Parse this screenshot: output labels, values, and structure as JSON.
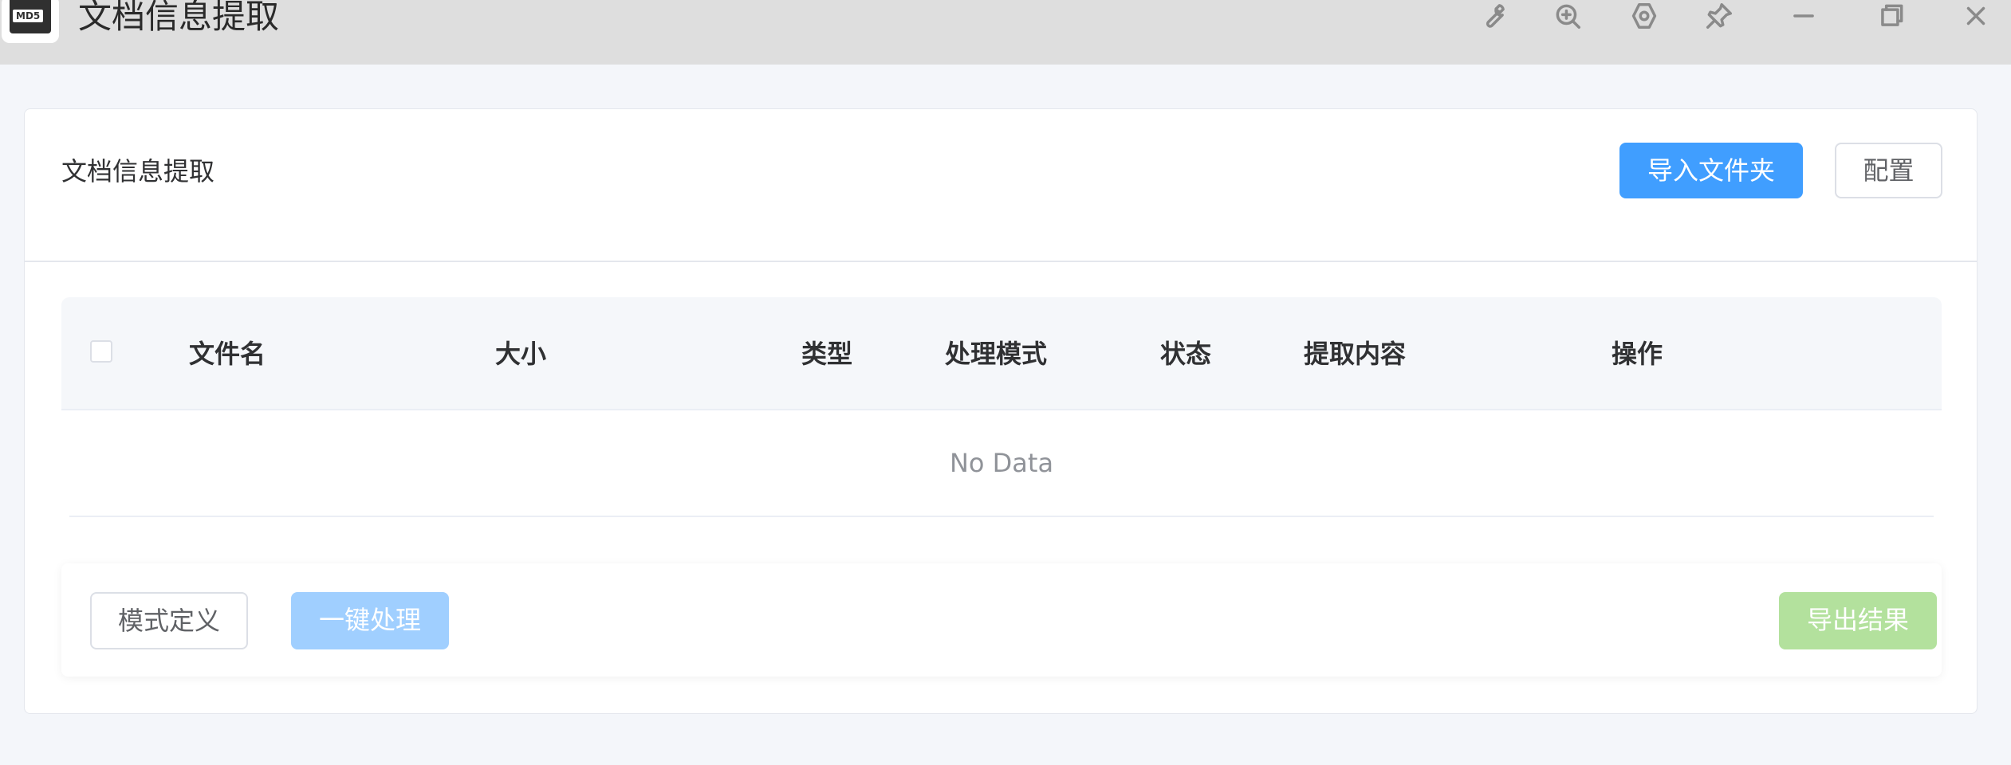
{
  "window": {
    "title": "文档信息提取",
    "logo_tag": "MD5"
  },
  "card": {
    "title": "文档信息提取",
    "import_folder_label": "导入文件夹",
    "config_label": "配置"
  },
  "table": {
    "columns": [
      "文件名",
      "大小",
      "类型",
      "处理模式",
      "状态",
      "提取内容",
      "操作"
    ],
    "rows": [],
    "empty_text": "No Data"
  },
  "footer": {
    "mode_define_label": "模式定义",
    "one_click_label": "一键处理",
    "export_label": "导出结果"
  },
  "colors": {
    "primary": "#409eff",
    "primary_disabled": "#a0cfff",
    "success_disabled": "#b3e19d",
    "titlebar": "#dedede",
    "background": "#f4f6fa"
  }
}
